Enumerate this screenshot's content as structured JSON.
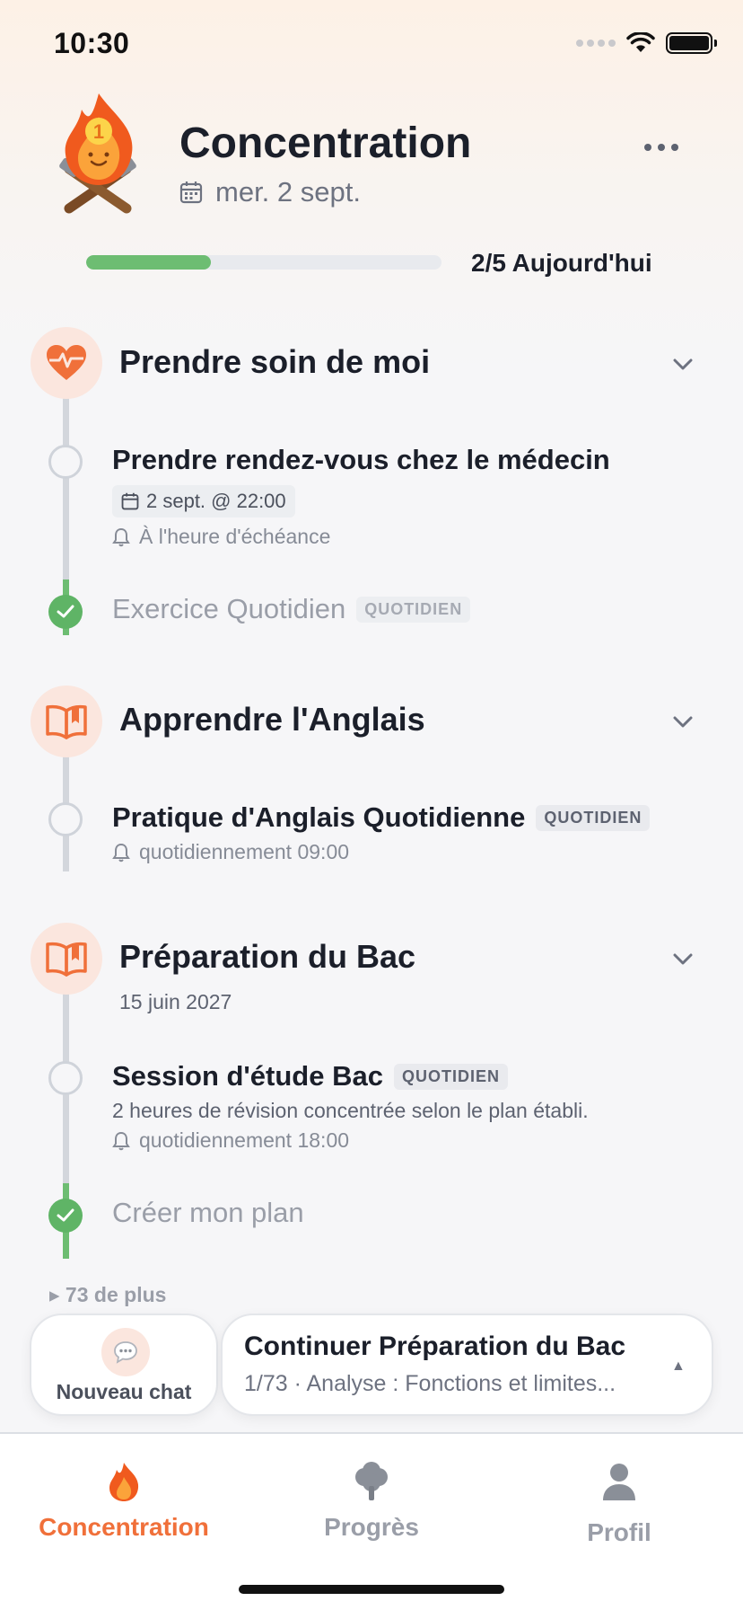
{
  "status_bar": {
    "time": "10:30"
  },
  "header": {
    "title": "Concentration",
    "date": "mer. 2 sept.",
    "progress_label": "2/5 Aujourd'hui",
    "progress_fraction": 0.35,
    "logo_badge": "1"
  },
  "groups": [
    {
      "title": "Prendre soin de moi",
      "icon": "heart-pulse-icon",
      "tasks": [
        {
          "title": "Prendre rendez-vous chez le médecin",
          "due": "2 sept. @ 22:00",
          "reminder": "À l'heure d'échéance",
          "done": false
        },
        {
          "title": "Exercice Quotidien",
          "badge": "QUOTIDIEN",
          "done": true
        }
      ]
    },
    {
      "title": "Apprendre l'Anglais",
      "icon": "open-book-icon",
      "tasks": [
        {
          "title": "Pratique d'Anglais Quotidienne",
          "badge": "QUOTIDIEN",
          "reminder": "quotidiennement 09:00",
          "done": false
        }
      ]
    },
    {
      "title": "Préparation du Bac",
      "subtitle": "15 juin 2027",
      "icon": "open-book-icon",
      "tasks": [
        {
          "title": "Session d'étude Bac",
          "badge": "QUOTIDIEN",
          "description": "2 heures de révision concentrée selon le plan établi.",
          "reminder": "quotidiennement 18:00",
          "done": false
        },
        {
          "title": "Créer mon plan",
          "done": true
        }
      ],
      "more": "▸ 73 de plus"
    }
  ],
  "bottom_cards": {
    "new_chat": "Nouveau chat",
    "continue_title": "Continuer Préparation du Bac",
    "continue_sub": "1/73 · Analyse : Fonctions et limites..."
  },
  "tabs": [
    {
      "label": "Concentration",
      "icon": "flame-icon",
      "active": true
    },
    {
      "label": "Progrès",
      "icon": "tree-icon",
      "active": false
    },
    {
      "label": "Profil",
      "icon": "person-icon",
      "active": false
    }
  ],
  "colors": {
    "accent": "#f0703a",
    "success": "#6dbd72",
    "rail": "#d3d6dc"
  }
}
